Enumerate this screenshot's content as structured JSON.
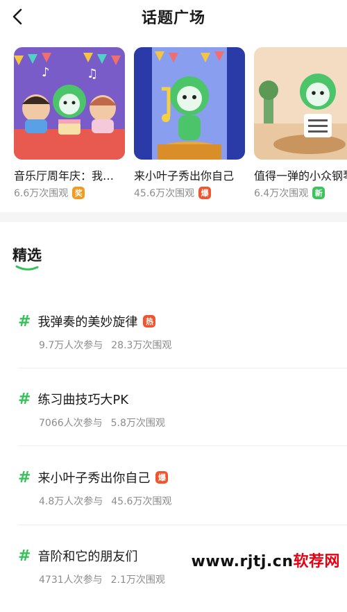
{
  "header": {
    "title": "话题广场"
  },
  "featured": [
    {
      "title": "音乐厅周年庆：我…",
      "views": "6.6万次围观",
      "badge": "奖",
      "badge_color": "#f39a1e",
      "bg": "#7a5cc8"
    },
    {
      "title": "来小叶子秀出你自己",
      "views": "45.6万次围观",
      "badge": "爆",
      "badge_color": "#f0552f",
      "bg": "#3c4fb8"
    },
    {
      "title": "值得一弹的小众钢琴曲",
      "views": "6.4万次围观",
      "badge": "新",
      "badge_color": "#3ac45a",
      "bg": "#f3dcc2"
    }
  ],
  "section": {
    "title": "精选"
  },
  "topics": [
    {
      "hash": "#",
      "name": "我弹奏的美妙旋律",
      "badge": "热",
      "badge_color": "#f0552f",
      "participants": "9.7万人次参与",
      "views": "28.3万次围观"
    },
    {
      "hash": "#",
      "name": "练习曲技巧大PK",
      "badge": "",
      "badge_color": "",
      "participants": "7066人次参与",
      "views": "5.8万次围观"
    },
    {
      "hash": "#",
      "name": "来小叶子秀出你自己",
      "badge": "爆",
      "badge_color": "#f0552f",
      "participants": "4.8万人次参与",
      "views": "45.6万次围观"
    },
    {
      "hash": "#",
      "name": "音阶和它的朋友们",
      "badge": "",
      "badge_color": "",
      "participants": "4731人次参与",
      "views": "2.1万次围观"
    }
  ],
  "watermark": {
    "prefix": "www.rjtj.cn",
    "suffix": "软荐网"
  }
}
